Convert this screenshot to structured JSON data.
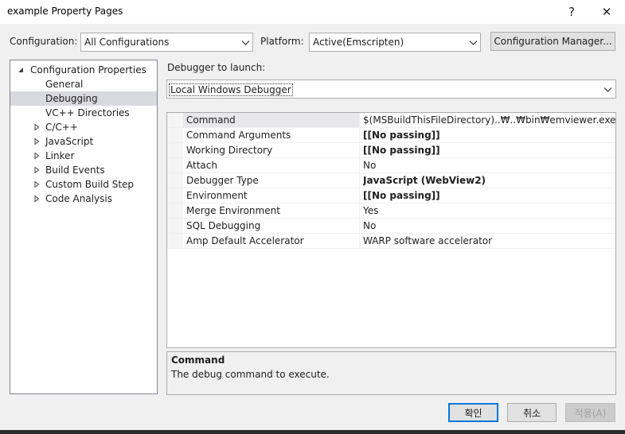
{
  "window": {
    "title": "example Property Pages",
    "help": "?",
    "close": "✕"
  },
  "config": {
    "configuration_label": "Configuration:",
    "configuration_value": "All Configurations",
    "platform_label": "Platform:",
    "platform_value": "Active(Emscripten)",
    "manager_button": "Configuration Manager..."
  },
  "tree": {
    "root": "Configuration Properties",
    "items": [
      {
        "label": "General"
      },
      {
        "label": "Debugging"
      },
      {
        "label": "VC++ Directories"
      },
      {
        "label": "C/C++"
      },
      {
        "label": "JavaScript"
      },
      {
        "label": "Linker"
      },
      {
        "label": "Build Events"
      },
      {
        "label": "Custom Build Step"
      },
      {
        "label": "Code Analysis"
      }
    ]
  },
  "debugger": {
    "label": "Debugger to launch:",
    "value": "Local Windows Debugger"
  },
  "grid": {
    "rows": [
      {
        "name": "Command",
        "value": "$(MSBuildThisFileDirectory)..₩..₩bin₩emviewer.exe"
      },
      {
        "name": "Command Arguments",
        "value": "[[No passing]]"
      },
      {
        "name": "Working Directory",
        "value": "[[No passing]]"
      },
      {
        "name": "Attach",
        "value": "No"
      },
      {
        "name": "Debugger Type",
        "value": "JavaScript (WebView2)"
      },
      {
        "name": "Environment",
        "value": "[[No passing]]"
      },
      {
        "name": "Merge Environment",
        "value": "Yes"
      },
      {
        "name": "SQL Debugging",
        "value": "No"
      },
      {
        "name": "Amp Default Accelerator",
        "value": "WARP software accelerator"
      }
    ]
  },
  "description": {
    "title": "Command",
    "text": "The debug command to execute."
  },
  "buttons": {
    "ok": "확인",
    "cancel": "취소",
    "apply": "적용(A)"
  }
}
